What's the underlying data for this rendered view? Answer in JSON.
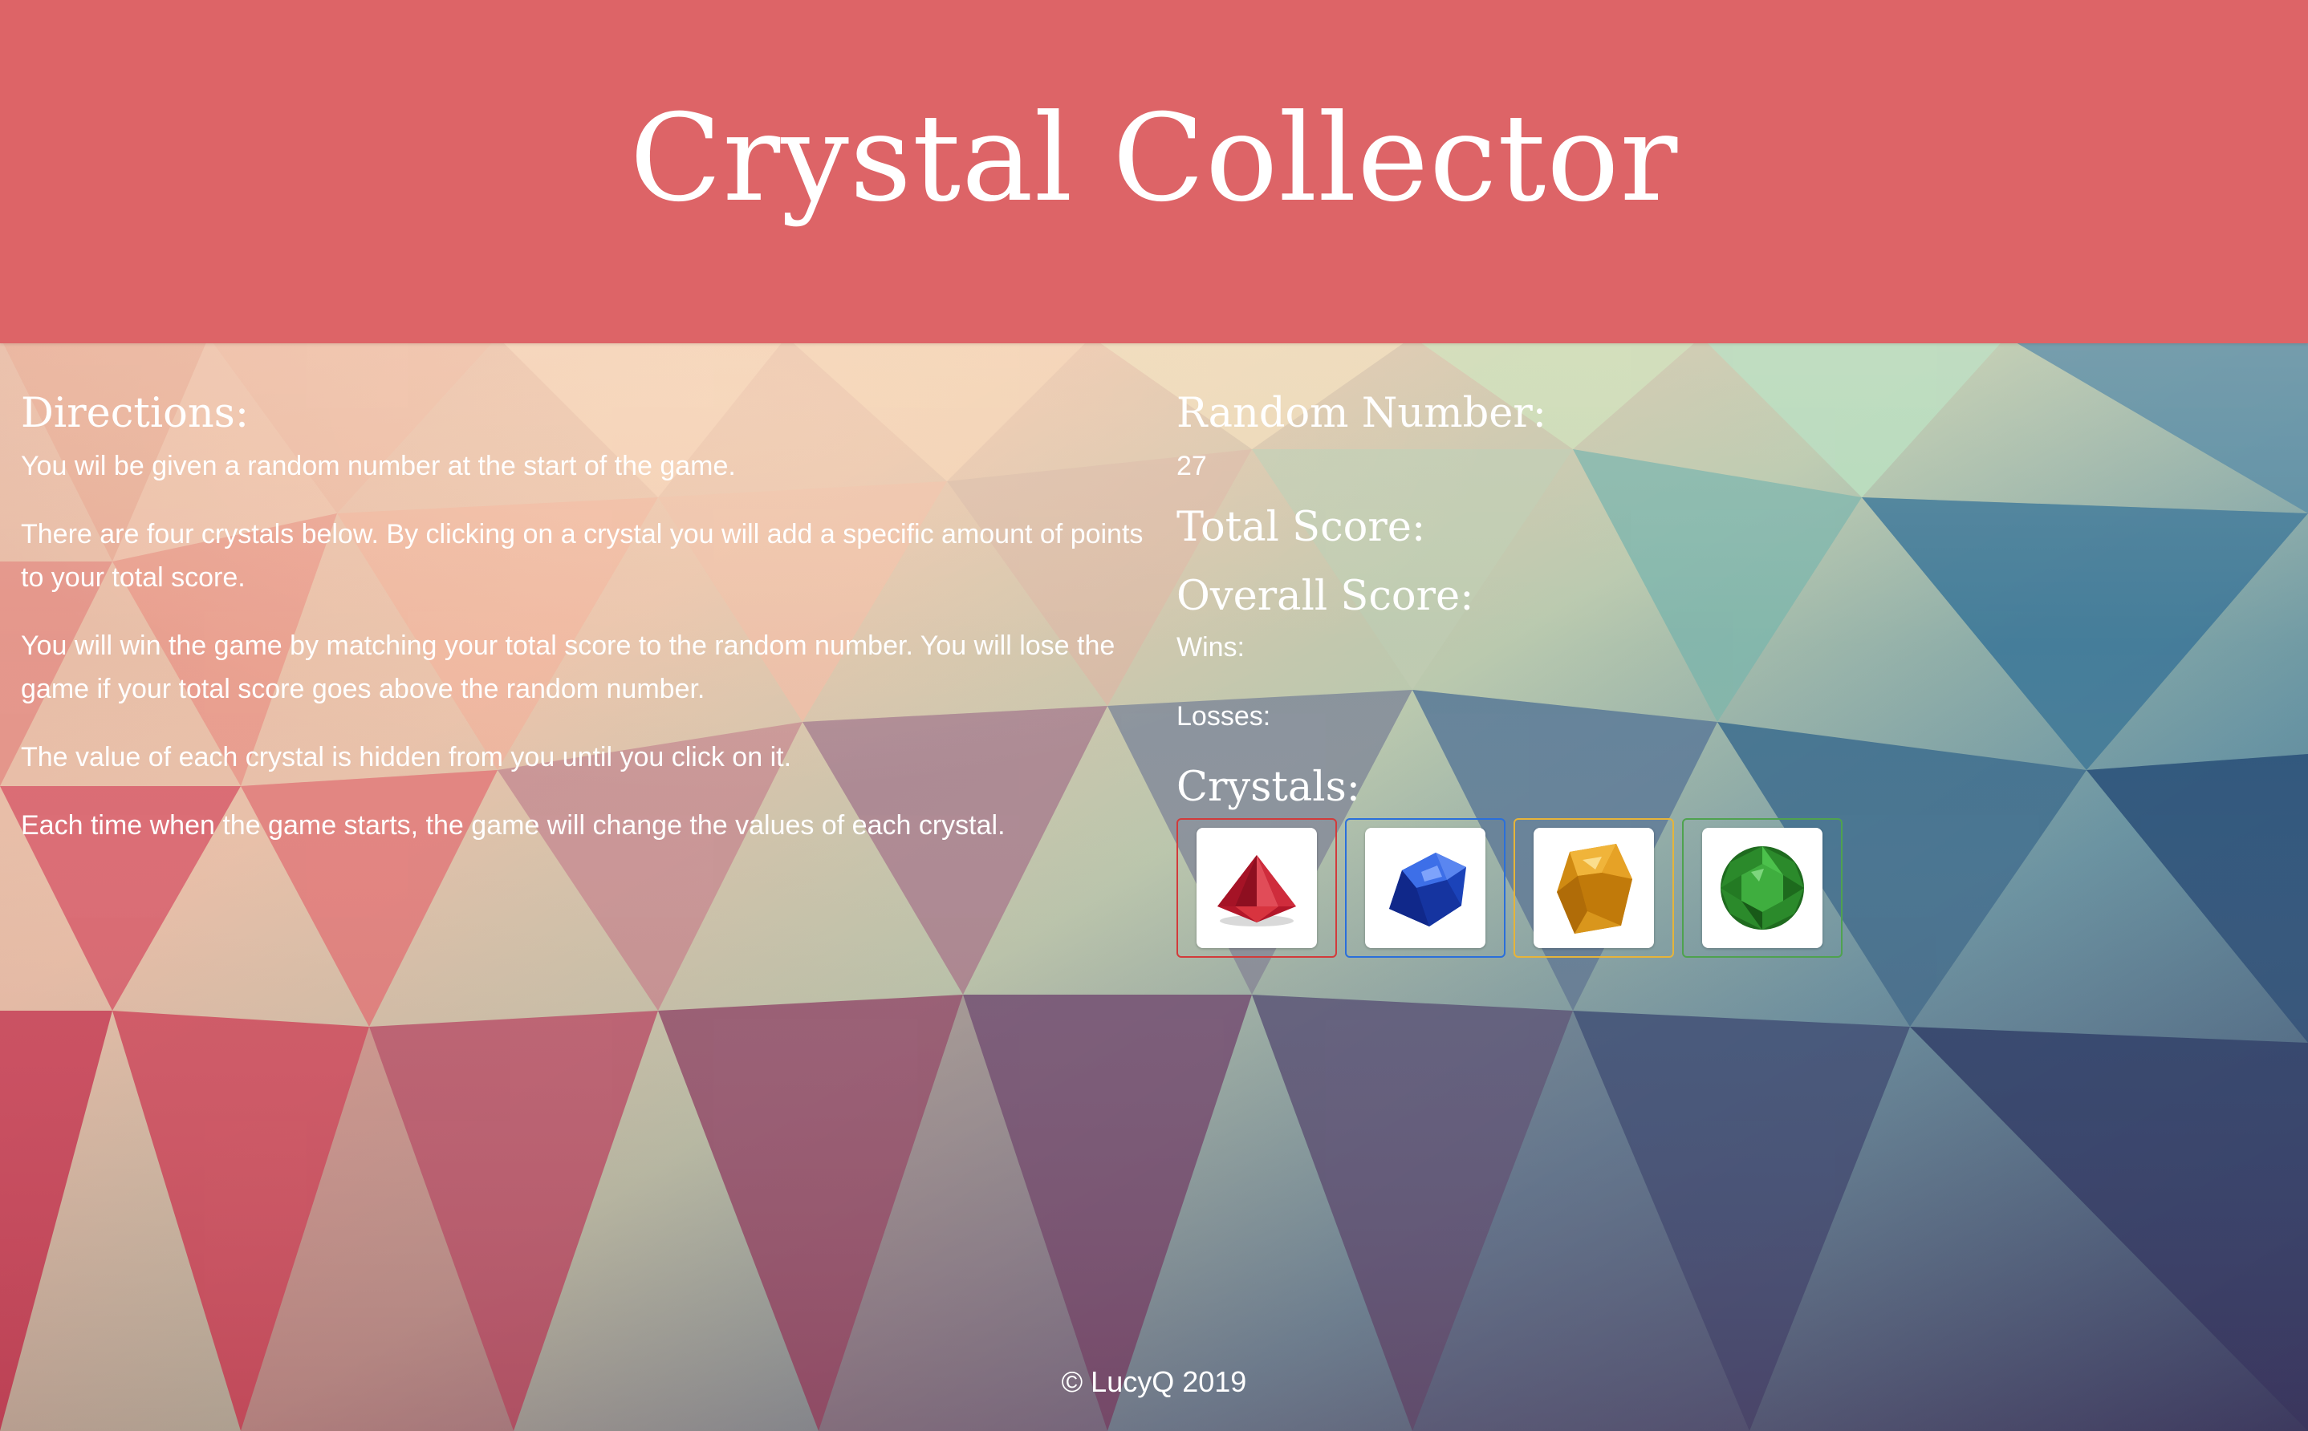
{
  "header": {
    "title": "Crystal Collector"
  },
  "directions": {
    "heading": "Directions:",
    "paragraphs": [
      "You wil be given a random number at the start of the game.",
      "There are four crystals below. By clicking on a crystal you will add a specific amount of points to your total score.",
      "You will win the game by matching your total score to the random number. You will lose the game if your total score goes above the random number.",
      "The value of each crystal is hidden from you until you click on it.",
      "Each time when the game starts, the game will change the values of each crystal."
    ]
  },
  "game": {
    "random_number_heading": "Random Number:",
    "random_number_value": "27",
    "total_score_heading": "Total Score:",
    "total_score_value": "",
    "overall_score_heading": "Overall Score:",
    "wins_label": "Wins:",
    "wins_value": "",
    "losses_label": "Losses:",
    "losses_value": "",
    "crystals_heading": "Crystals:"
  },
  "crystals": [
    {
      "name": "red-crystal-icon",
      "border_color": "#d23b3b",
      "gem_color": "#c0272d"
    },
    {
      "name": "blue-crystal-icon",
      "border_color": "#2a6fdb",
      "gem_color": "#1f4fc6"
    },
    {
      "name": "yellow-crystal-icon",
      "border_color": "#e6b43a",
      "gem_color": "#d99a1c"
    },
    {
      "name": "green-crystal-icon",
      "border_color": "#4fa24f",
      "gem_color": "#2f8a2f"
    }
  ],
  "footer": {
    "text": "© LucyQ 2019"
  },
  "colors": {
    "header_bg": "#dd6467",
    "text": "#ffffff"
  }
}
